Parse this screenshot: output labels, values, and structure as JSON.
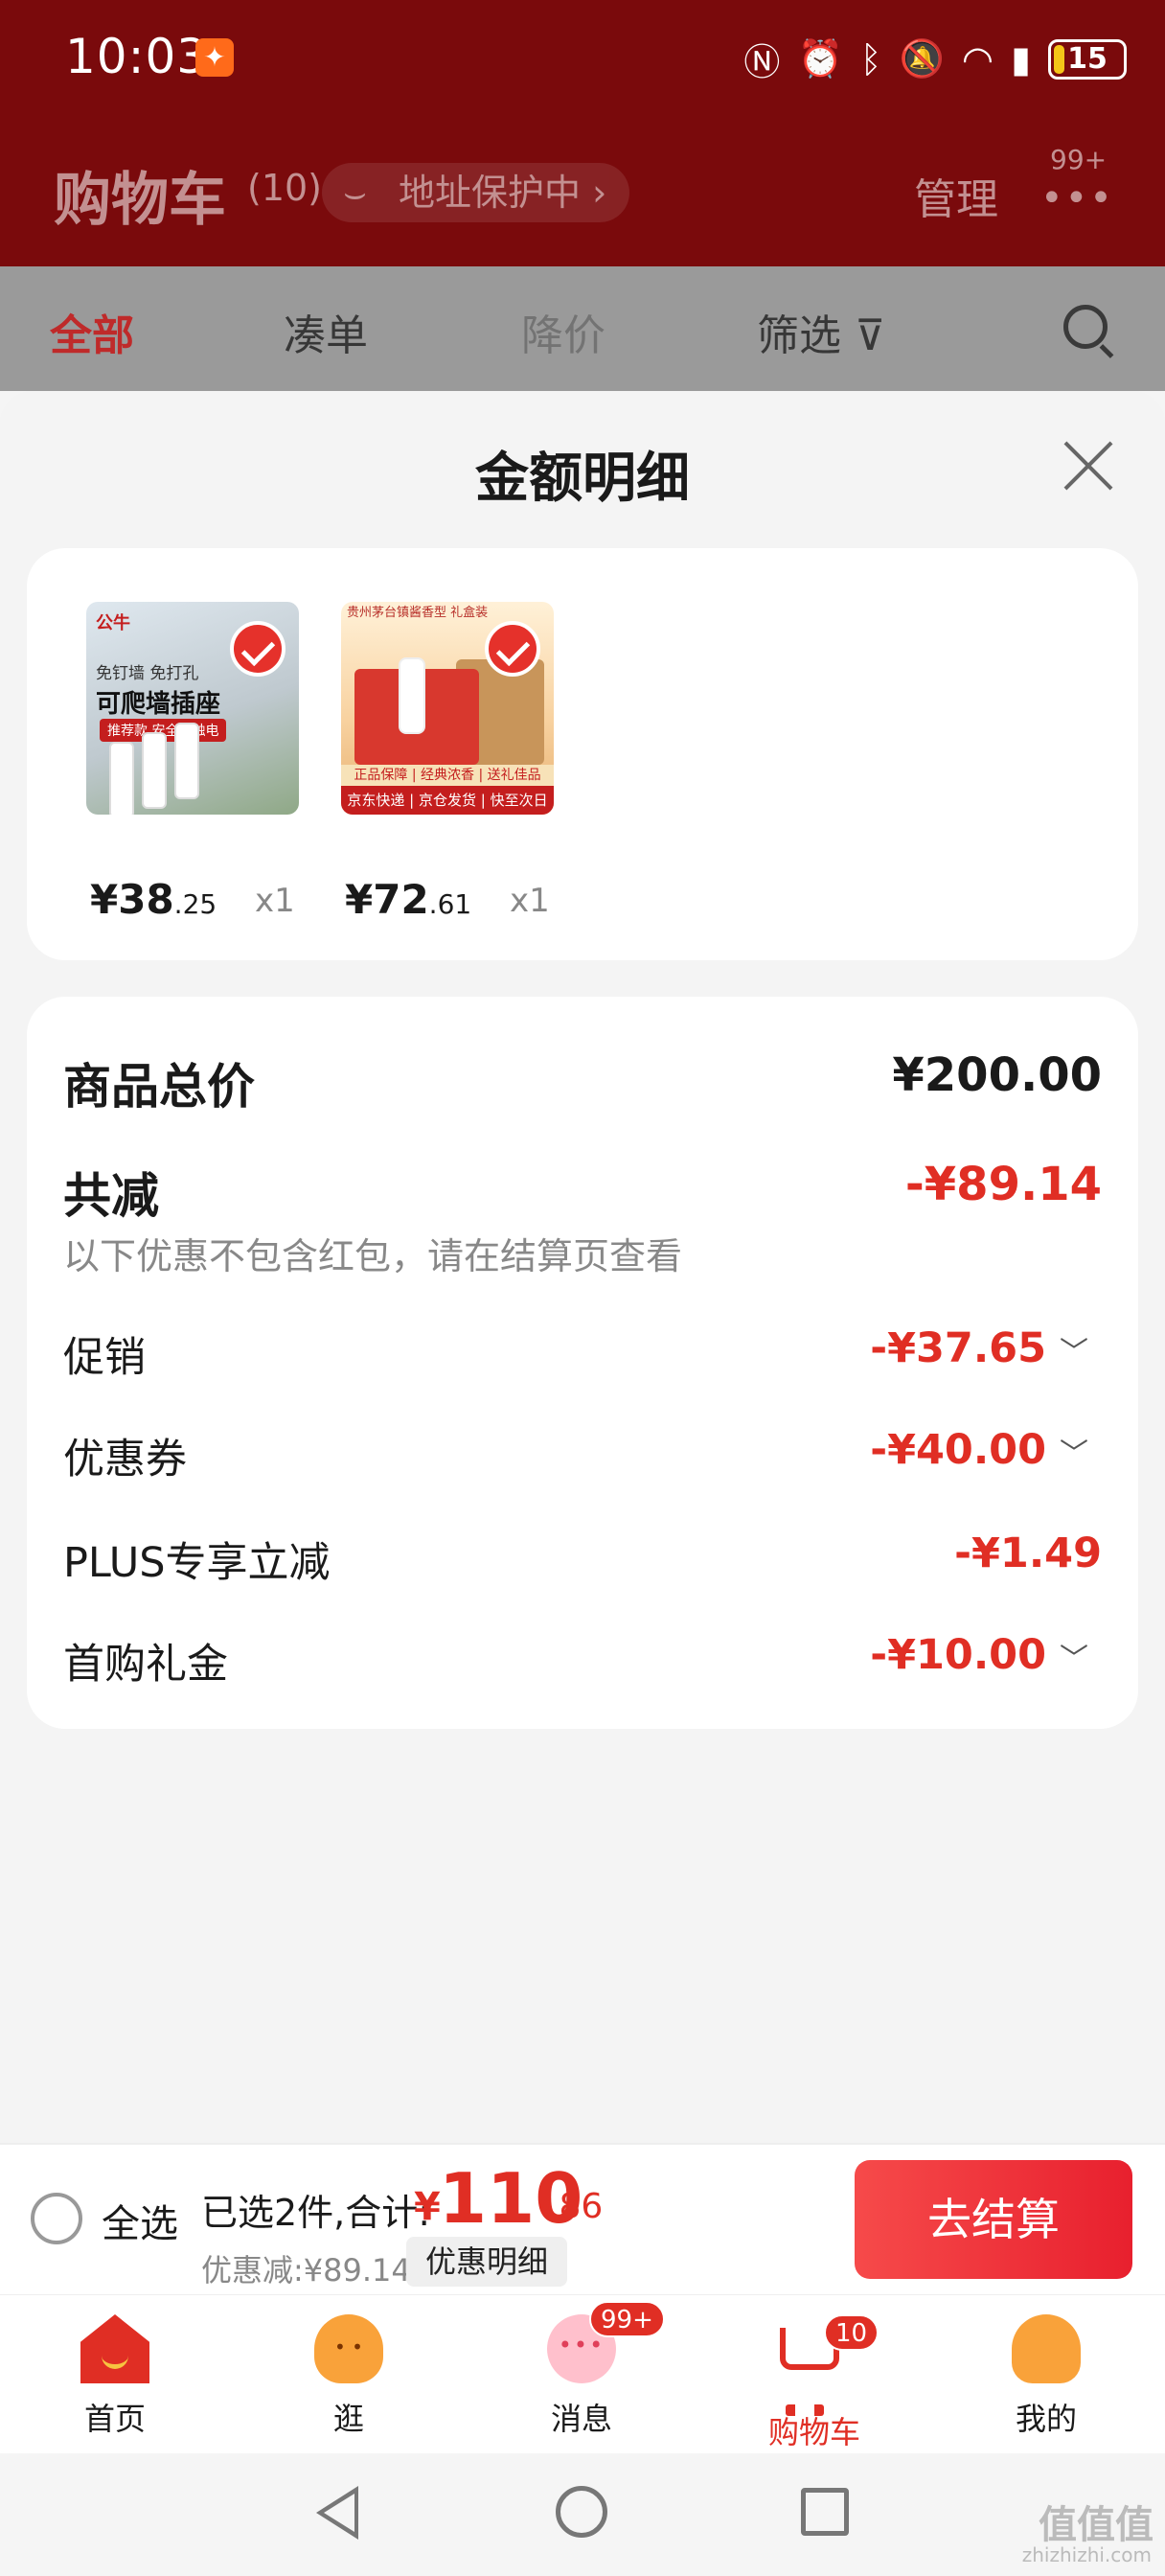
{
  "status_bar": {
    "time": "10:03",
    "icons": [
      "nfc-icon",
      "alarm-icon",
      "bluetooth-icon",
      "mute-icon",
      "wifi-icon",
      "signal-icon"
    ],
    "battery_level": "15"
  },
  "header": {
    "title": "购物车",
    "count": "(10)",
    "address_protect": "地址保护中",
    "manage": "管理",
    "more_badge": "99+"
  },
  "tabs": {
    "all": "全部",
    "bundle": "凑单",
    "price_drop": "降价",
    "filter": "筛选"
  },
  "sheet": {
    "title": "金额明细",
    "products": [
      {
        "image_text": {
          "brand": "公牛",
          "line1": "免钉墙 免打孔",
          "headline": "可爬墙插座",
          "tag": "推荐款 安全防触电"
        },
        "price_int": "¥38",
        "price_dec": ".25",
        "qty": "x1"
      },
      {
        "image_text": {
          "head": "贵州茅台镇酱香型 礼盒装",
          "bar_top": "正品保障 | 经典浓香 | 送礼佳品",
          "bar_bottom": "京东快递 | 京仓发货 | 快至次日达"
        },
        "price_int": "¥72",
        "price_dec": ".61",
        "qty": "x1"
      }
    ],
    "summary": {
      "total_label": "商品总价",
      "total_value": "¥200.00",
      "reduce_label": "共减",
      "reduce_value": "-¥89.14",
      "note": "以下优惠不包含红包，请在结算页查看",
      "items": [
        {
          "label": "促销",
          "value": "-¥37.65",
          "expandable": true
        },
        {
          "label": "优惠券",
          "value": "-¥40.00",
          "expandable": true
        },
        {
          "label": "PLUS专享立减",
          "value": "-¥1.49",
          "expandable": false
        },
        {
          "label": "首购礼金",
          "value": "-¥10.00",
          "expandable": true
        }
      ]
    }
  },
  "checkout": {
    "select_all": "全选",
    "selected_text": "已选2件,合计:",
    "total_currency": "¥",
    "total_int": "110",
    "total_dec": ".86",
    "discount_text": "优惠减:¥89.14",
    "detail_button": "优惠明细",
    "checkout_button": "去结算"
  },
  "tabbar": {
    "items": [
      {
        "label": "首页",
        "icon": "home-icon"
      },
      {
        "label": "逛",
        "icon": "discover-icon"
      },
      {
        "label": "消息",
        "icon": "message-icon",
        "badge": "99+"
      },
      {
        "label": "购物车",
        "icon": "cart-icon",
        "badge": "10",
        "active": true
      },
      {
        "label": "我的",
        "icon": "profile-icon"
      }
    ]
  },
  "watermark": {
    "main": "值值值",
    "sub": "zhizhizhi.com"
  },
  "colors": {
    "accent": "#e02e24",
    "header_bg": "#7a0a0c",
    "checkout_button": "#f03c3c"
  }
}
